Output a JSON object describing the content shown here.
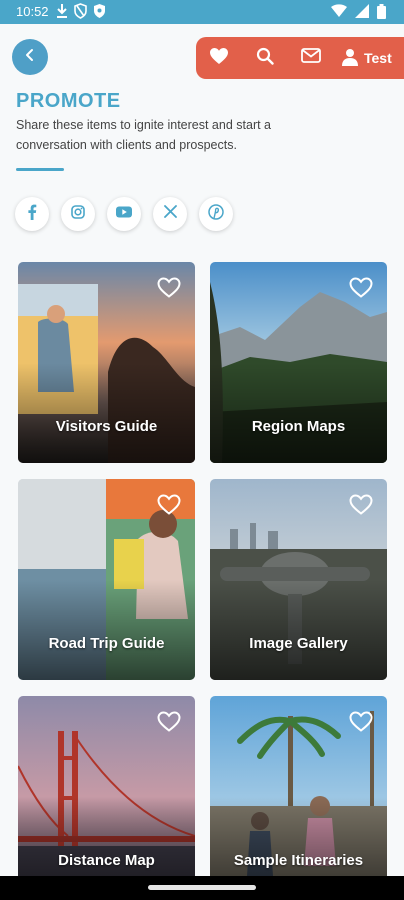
{
  "status_bar": {
    "time": "10:52",
    "left_icons": [
      "download-icon",
      "shield-icon",
      "vpn-icon"
    ],
    "right_icons": [
      "wifi-icon",
      "signal-icon",
      "battery-icon"
    ]
  },
  "header": {
    "back_icon": "chevron-left-icon",
    "actions": [
      "heart-icon",
      "search-icon",
      "mail-icon"
    ],
    "user_label": "Test"
  },
  "page": {
    "title": "PROMOTE",
    "subtitle": "Share these items to ignite interest and start a conversation with clients and prospects."
  },
  "socials": [
    "facebook-icon",
    "instagram-icon",
    "youtube-icon",
    "x-icon",
    "pinterest-icon"
  ],
  "cards": [
    {
      "label": "Visitors Guide"
    },
    {
      "label": "Region Maps"
    },
    {
      "label": "Road Trip Guide"
    },
    {
      "label": "Image Gallery"
    },
    {
      "label": "Distance Map"
    },
    {
      "label": "Sample Itineraries"
    }
  ],
  "colors": {
    "accent": "#4aa6c9",
    "action_bar": "#e2604a"
  }
}
